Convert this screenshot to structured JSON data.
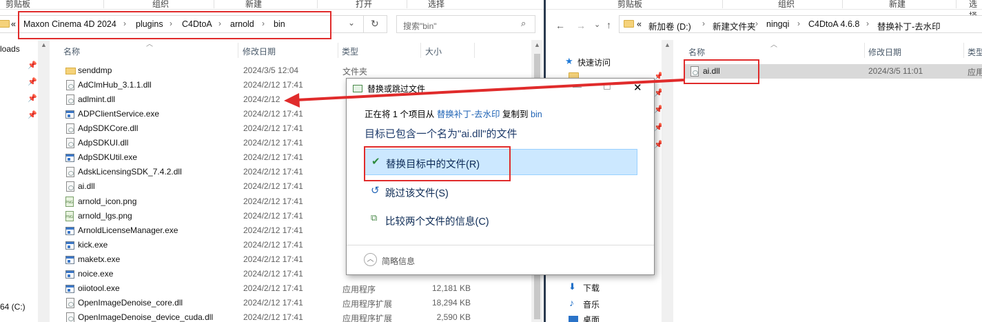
{
  "left_window": {
    "ribbon": [
      "剪贴板",
      "组织",
      "新建",
      "打开",
      "选择"
    ],
    "address": {
      "overflow": "«",
      "crumbs": [
        "Maxon Cinema 4D 2024",
        "plugins",
        "C4DtoA",
        "arnold",
        "bin"
      ]
    },
    "search_placeholder": "搜索\"bin\"",
    "columns": {
      "name": "名称",
      "date": "修改日期",
      "type": "类型",
      "size": "大小"
    },
    "nav": {
      "item1": "loads",
      "item2": "64 (C:)"
    },
    "files": [
      {
        "name": "senddmp",
        "date": "2024/3/5 12:04",
        "type": "文件夹",
        "size": "",
        "icon": "folder"
      },
      {
        "name": "AdClmHub_3.1.1.dll",
        "date": "2024/2/12 17:41",
        "type": "",
        "size": "",
        "icon": "dll"
      },
      {
        "name": "adlmint.dll",
        "date": "2024/2/12",
        "type": "",
        "size": "",
        "icon": "dll"
      },
      {
        "name": "ADPClientService.exe",
        "date": "2024/2/12 17:41",
        "type": "",
        "size": "",
        "icon": "exe"
      },
      {
        "name": "AdpSDKCore.dll",
        "date": "2024/2/12 17:41",
        "type": "",
        "size": "",
        "icon": "dll"
      },
      {
        "name": "AdpSDKUI.dll",
        "date": "2024/2/12 17:41",
        "type": "",
        "size": "",
        "icon": "dll"
      },
      {
        "name": "AdpSDKUtil.exe",
        "date": "2024/2/12 17:41",
        "type": "",
        "size": "",
        "icon": "exe"
      },
      {
        "name": "AdskLicensingSDK_7.4.2.dll",
        "date": "2024/2/12 17:41",
        "type": "",
        "size": "",
        "icon": "dll"
      },
      {
        "name": "ai.dll",
        "date": "2024/2/12 17:41",
        "type": "",
        "size": "",
        "icon": "dll"
      },
      {
        "name": "arnold_icon.png",
        "date": "2024/2/12 17:41",
        "type": "",
        "size": "",
        "icon": "png"
      },
      {
        "name": "arnold_lgs.png",
        "date": "2024/2/12 17:41",
        "type": "",
        "size": "",
        "icon": "png"
      },
      {
        "name": "ArnoldLicenseManager.exe",
        "date": "2024/2/12 17:41",
        "type": "",
        "size": "",
        "icon": "exe"
      },
      {
        "name": "kick.exe",
        "date": "2024/2/12 17:41",
        "type": "",
        "size": "",
        "icon": "exe"
      },
      {
        "name": "maketx.exe",
        "date": "2024/2/12 17:41",
        "type": "",
        "size": "",
        "icon": "exe"
      },
      {
        "name": "noice.exe",
        "date": "2024/2/12 17:41",
        "type": "",
        "size": "",
        "icon": "exe"
      },
      {
        "name": "oiiotool.exe",
        "date": "2024/2/12 17:41",
        "type": "应用程序",
        "size": "12,181 KB",
        "icon": "exe"
      },
      {
        "name": "OpenImageDenoise_core.dll",
        "date": "2024/2/12 17:41",
        "type": "应用程序扩展",
        "size": "18,294 KB",
        "icon": "dll"
      },
      {
        "name": "OpenImageDenoise_device_cuda.dll",
        "date": "2024/2/12 17:41",
        "type": "应用程序扩展",
        "size": "2,590 KB",
        "icon": "dll"
      }
    ]
  },
  "right_window": {
    "ribbon": [
      "剪贴板",
      "组织",
      "新建",
      "选择"
    ],
    "address": {
      "overflow": "«",
      "crumbs": [
        "新加卷 (D:)",
        "新建文件夹",
        "ningqi",
        "C4DtoA 4.6.8",
        "替换补丁-去水印"
      ]
    },
    "columns": {
      "name": "名称",
      "date": "修改日期",
      "type": "类型"
    },
    "nav_items": [
      "快速访问",
      "下载",
      "音乐",
      "桌面"
    ],
    "files": [
      {
        "name": "ai.dll",
        "date": "2024/3/5 11:01",
        "type": "应用"
      }
    ]
  },
  "dialog": {
    "title": "替换或跳过文件",
    "line1_prefix": "正在将 1 个项目从",
    "line1_source": "替换补丁-去水印",
    "line1_middle": "复制到",
    "line1_dest": "bin",
    "heading": "目标已包含一个名为\"ai.dll\"的文件",
    "options": [
      {
        "label": "替换目标中的文件(R)",
        "icon": "check-icon"
      },
      {
        "label": "跳过该文件(S)",
        "icon": "skip-icon"
      },
      {
        "label": "比较两个文件的信息(C)",
        "icon": "compare-icon"
      }
    ],
    "footer": "简略信息"
  },
  "colors": {
    "highlight": "#e02b2b",
    "accent": "#1f63b5",
    "selected": "#cce8ff"
  }
}
